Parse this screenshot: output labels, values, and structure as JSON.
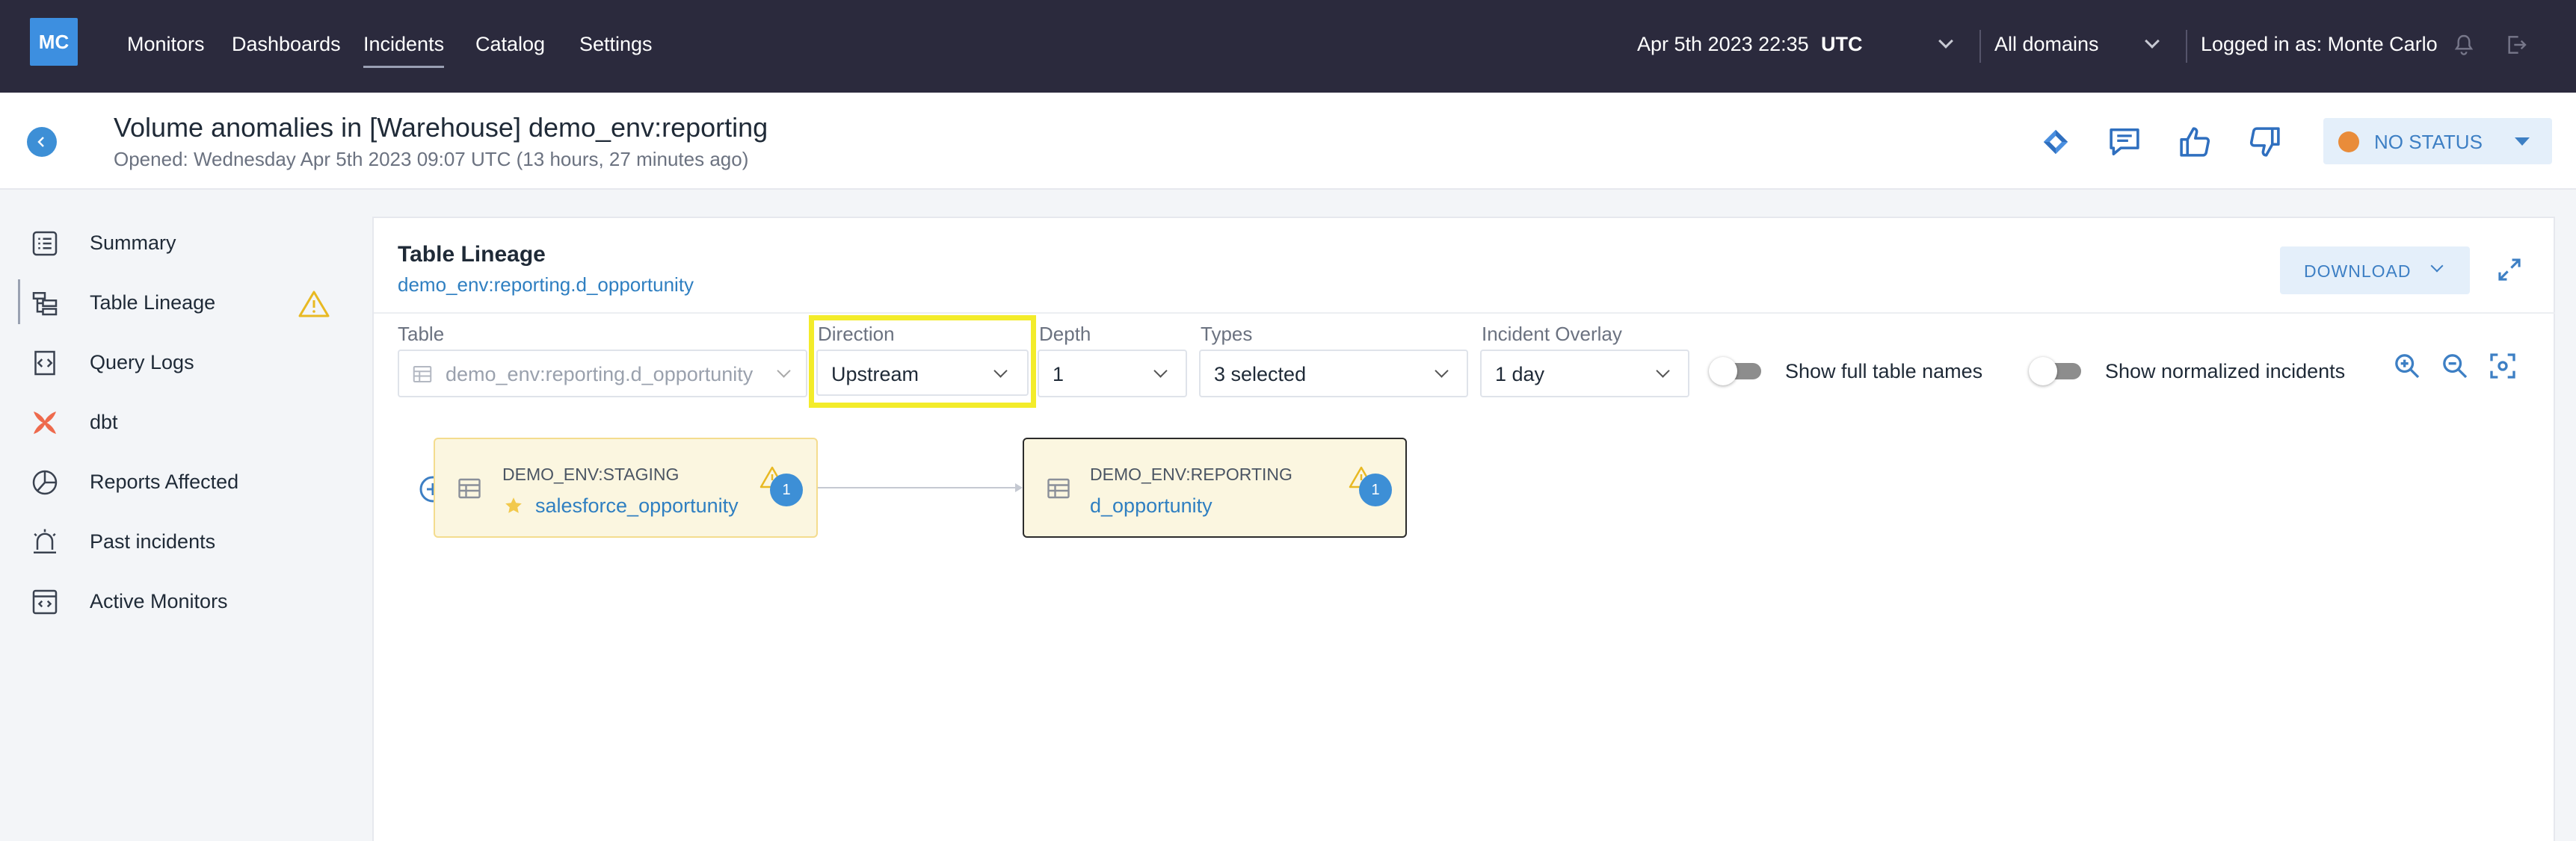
{
  "nav": {
    "logo": "MC",
    "items": [
      {
        "label": "Monitors"
      },
      {
        "label": "Dashboards"
      },
      {
        "label": "Incidents"
      },
      {
        "label": "Catalog"
      },
      {
        "label": "Settings"
      }
    ],
    "active": "Incidents",
    "datetime": "Apr 5th 2023 22:35",
    "timezone": "UTC",
    "domain_select": "All domains",
    "logged_in": "Logged in as: Monte Carlo",
    "icons": [
      "bell-icon",
      "logout-icon"
    ]
  },
  "header": {
    "title": "Volume anomalies in [Warehouse] demo_env:reporting",
    "subtitle": "Opened: Wednesday Apr 5th 2023 09:07 UTC (13 hours, 27 minutes ago)",
    "actions": [
      "jira-icon",
      "comment-icon",
      "thumbs-up-icon",
      "thumbs-down-icon"
    ],
    "status": "NO STATUS",
    "status_color": "#e98c3a"
  },
  "sidebar": {
    "items": [
      {
        "label": "Summary",
        "icon": "list-icon"
      },
      {
        "label": "Table Lineage",
        "icon": "lineage-icon",
        "has_warning": true
      },
      {
        "label": "Query Logs",
        "icon": "code-icon"
      },
      {
        "label": "dbt",
        "icon": "dbt-icon"
      },
      {
        "label": "Reports Affected",
        "icon": "pie-chart-icon"
      },
      {
        "label": "Past incidents",
        "icon": "siren-icon"
      },
      {
        "label": "Active Monitors",
        "icon": "monitor-window-icon"
      }
    ],
    "active": "Table Lineage"
  },
  "lineage": {
    "title": "Table Lineage",
    "table_link": "demo_env:reporting.d_opportunity",
    "download_label": "DOWNLOAD",
    "filters": {
      "table_label": "Table",
      "table_value": "demo_env:reporting.d_opportunity",
      "direction_label": "Direction",
      "direction_value": "Upstream",
      "depth_label": "Depth",
      "depth_value": "1",
      "types_label": "Types",
      "types_value": "3 selected",
      "overlay_label": "Incident Overlay",
      "overlay_value": "1 day"
    },
    "toggles": {
      "full_names_label": "Show full table names",
      "full_names_on": false,
      "normalized_label": "Show normalized incidents",
      "normalized_on": false
    },
    "nodes": [
      {
        "schema": "DEMO_ENV:STAGING",
        "table": "salesforce_opportunity",
        "incidents": "1",
        "starred": true
      },
      {
        "schema": "DEMO_ENV:REPORTING",
        "table": "d_opportunity",
        "incidents": "1",
        "starred": false
      }
    ]
  }
}
